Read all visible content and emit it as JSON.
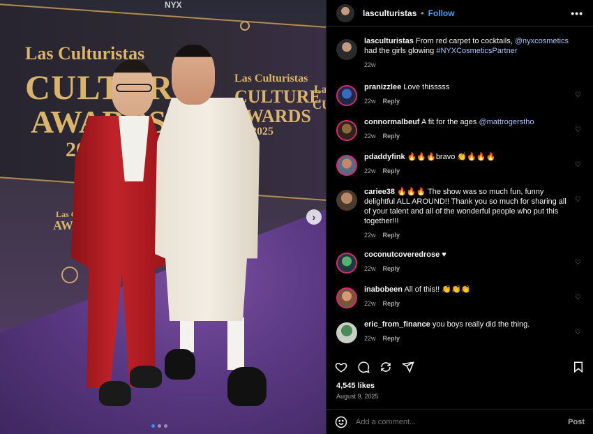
{
  "post": {
    "username": "lasculturistas",
    "follow_label": "Follow",
    "separator": "•",
    "more_label": "•••",
    "caption_user": "lasculturistas",
    "caption_text": " From red carpet to cocktails, ",
    "caption_mention": "@nyxcosmetics",
    "caption_mid": " had the girls glowing ",
    "caption_hashtag": "#NYXCosmeticsPartner",
    "caption_time": "22w",
    "likes": "4,545 likes",
    "date": "August 9, 2025",
    "comment_placeholder": "Add a comment...",
    "post_label": "Post"
  },
  "photo": {
    "brand_line1": "Las Culturistas",
    "brand_line2": "CULTURE",
    "brand_line3": "AWARDS",
    "brand_line4": "2025",
    "small_brand_1": "Las Culturistas",
    "small_brand_2": "CULTURE",
    "small_brand_3": "AWARDS",
    "small_brand_4": "2025",
    "side_brand_1": "Las",
    "side_brand_2": "CUL",
    "nyx_label": "NYX",
    "mini_brand_1": "Las Culturistas",
    "mini_brand_2": "AWARDS",
    "next_label": "›"
  },
  "comments": [
    {
      "user": "pranizzlee",
      "text": " Love thisssss",
      "time": "22w",
      "reply": "Reply"
    },
    {
      "user": "connormalbeuf",
      "text": " A fit for the ages ",
      "mention": "@mattrogerstho",
      "time": "22w",
      "reply": "Reply"
    },
    {
      "user": "pdaddyfink",
      "text": " 🔥🔥🔥bravo 👏🔥🔥🔥",
      "time": "22w",
      "reply": "Reply"
    },
    {
      "user": "cariee38",
      "text": " 🔥🔥🔥 The show was so much fun, funny delightful ALL AROUND!! Thank you so much for sharing all of your talent and all of the wonderful people who put this together!!!",
      "time": "22w",
      "reply": "Reply"
    },
    {
      "user": "coconutcoveredrose",
      "text": " ♥",
      "time": "22w",
      "reply": "Reply"
    },
    {
      "user": "inabobeen",
      "text": " All of this!! 👏👏👏",
      "time": "22w",
      "reply": "Reply"
    },
    {
      "user": "eric_from_finance",
      "text": " you boys really did the thing.",
      "time": "22w",
      "reply": "Reply"
    }
  ],
  "icons": {
    "heart": "heart-icon",
    "comment": "comment-icon",
    "share": "share-icon",
    "send": "send-icon",
    "bookmark": "bookmark-icon",
    "emoji": "emoji-icon"
  },
  "colors": {
    "link": "#4a9df8",
    "mention": "#a9c1ff",
    "muted": "#a8a8a8",
    "background": "#000000"
  }
}
